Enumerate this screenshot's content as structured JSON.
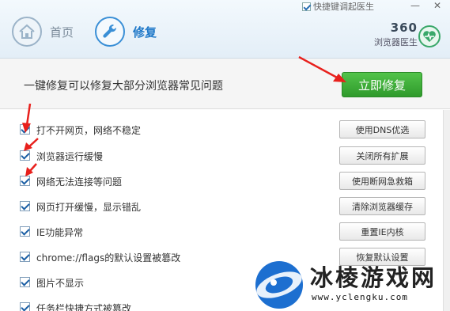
{
  "header": {
    "tabs": [
      {
        "label": "首页",
        "icon": "home-icon"
      },
      {
        "label": "修复",
        "icon": "wrench-icon"
      }
    ],
    "hotkey_checkbox": {
      "label": "快捷键调起医生",
      "checked": true
    },
    "window_buttons": {
      "minimize": "—",
      "close": "✕"
    },
    "brand": {
      "number": "360",
      "name": "浏览器医生",
      "icon": "heart-pulse-icon",
      "accent": "#3aa86a"
    }
  },
  "action": {
    "description": "一键修复可以修复大部分浏览器常见问题",
    "button_label": "立即修复",
    "button_color": "#3aa63a"
  },
  "items": [
    {
      "label": "打不开网页，网络不稳定",
      "checked": true,
      "button": "使用DNS优选"
    },
    {
      "label": "浏览器运行缓慢",
      "checked": true,
      "button": "关闭所有扩展"
    },
    {
      "label": "网络无法连接等问题",
      "checked": true,
      "button": "使用断网急救箱"
    },
    {
      "label": "网页打开缓慢，显示错乱",
      "checked": true,
      "button": "清除浏览器缓存"
    },
    {
      "label": "IE功能异常",
      "checked": true,
      "button": "重置IE内核"
    },
    {
      "label": "chrome://flags的默认设置被篡改",
      "checked": true,
      "button": "恢复默认设置"
    },
    {
      "label": "图片不显示",
      "checked": true,
      "button": ""
    },
    {
      "label": "任务栏快捷方式被篡改",
      "checked": true,
      "button": ""
    }
  ],
  "annotation_color": "#e8201c",
  "watermark": {
    "text": "冰棱游戏网",
    "url": "www.yclengku.com",
    "logo": "ice-logo-icon"
  }
}
